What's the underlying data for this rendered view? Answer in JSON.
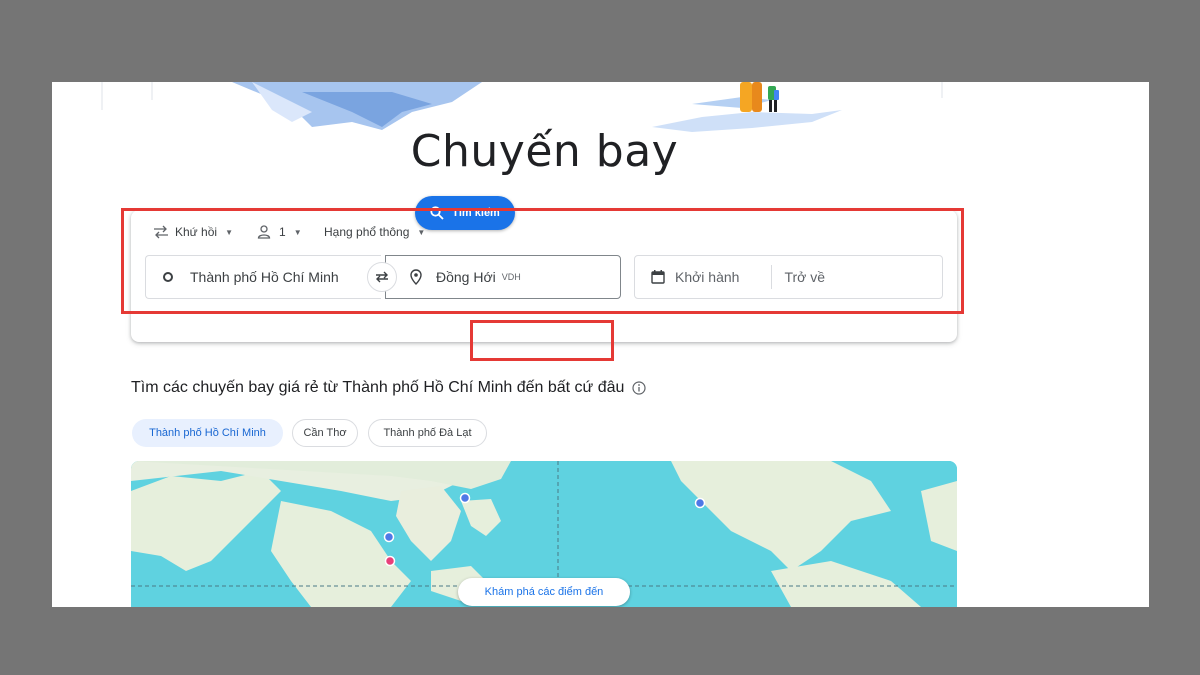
{
  "page": {
    "title": "Chuyến bay"
  },
  "search": {
    "trip_type": "Khứ hồi",
    "passengers": "1",
    "cabin_class": "Hạng phổ thông",
    "origin": "Thành phố Hồ Chí Minh",
    "destination": "Đồng Hới",
    "destination_code": "VDH",
    "depart_placeholder": "Khởi hành",
    "return_placeholder": "Trở về",
    "search_label": "Tìm kiếm"
  },
  "explore": {
    "heading": "Tìm các chuyến bay giá rẻ từ Thành phố Hồ Chí Minh đến bất cứ đâu",
    "chips": [
      "Thành phố Hồ Chí Minh",
      "Cần Thơ",
      "Thành phố Đà Lạt"
    ],
    "map_button": "Khám phá các điểm đến"
  },
  "colors": {
    "accent": "#1a73e8",
    "highlight": "#e53935",
    "chip_active_bg": "#e8f0fe",
    "ocean": "#5fd2e0",
    "land": "#e6efdc"
  },
  "icons": [
    "swap-icon",
    "person-icon",
    "circle-icon",
    "pin-icon",
    "calendar-icon",
    "search-icon",
    "info-icon",
    "caret-icon"
  ]
}
